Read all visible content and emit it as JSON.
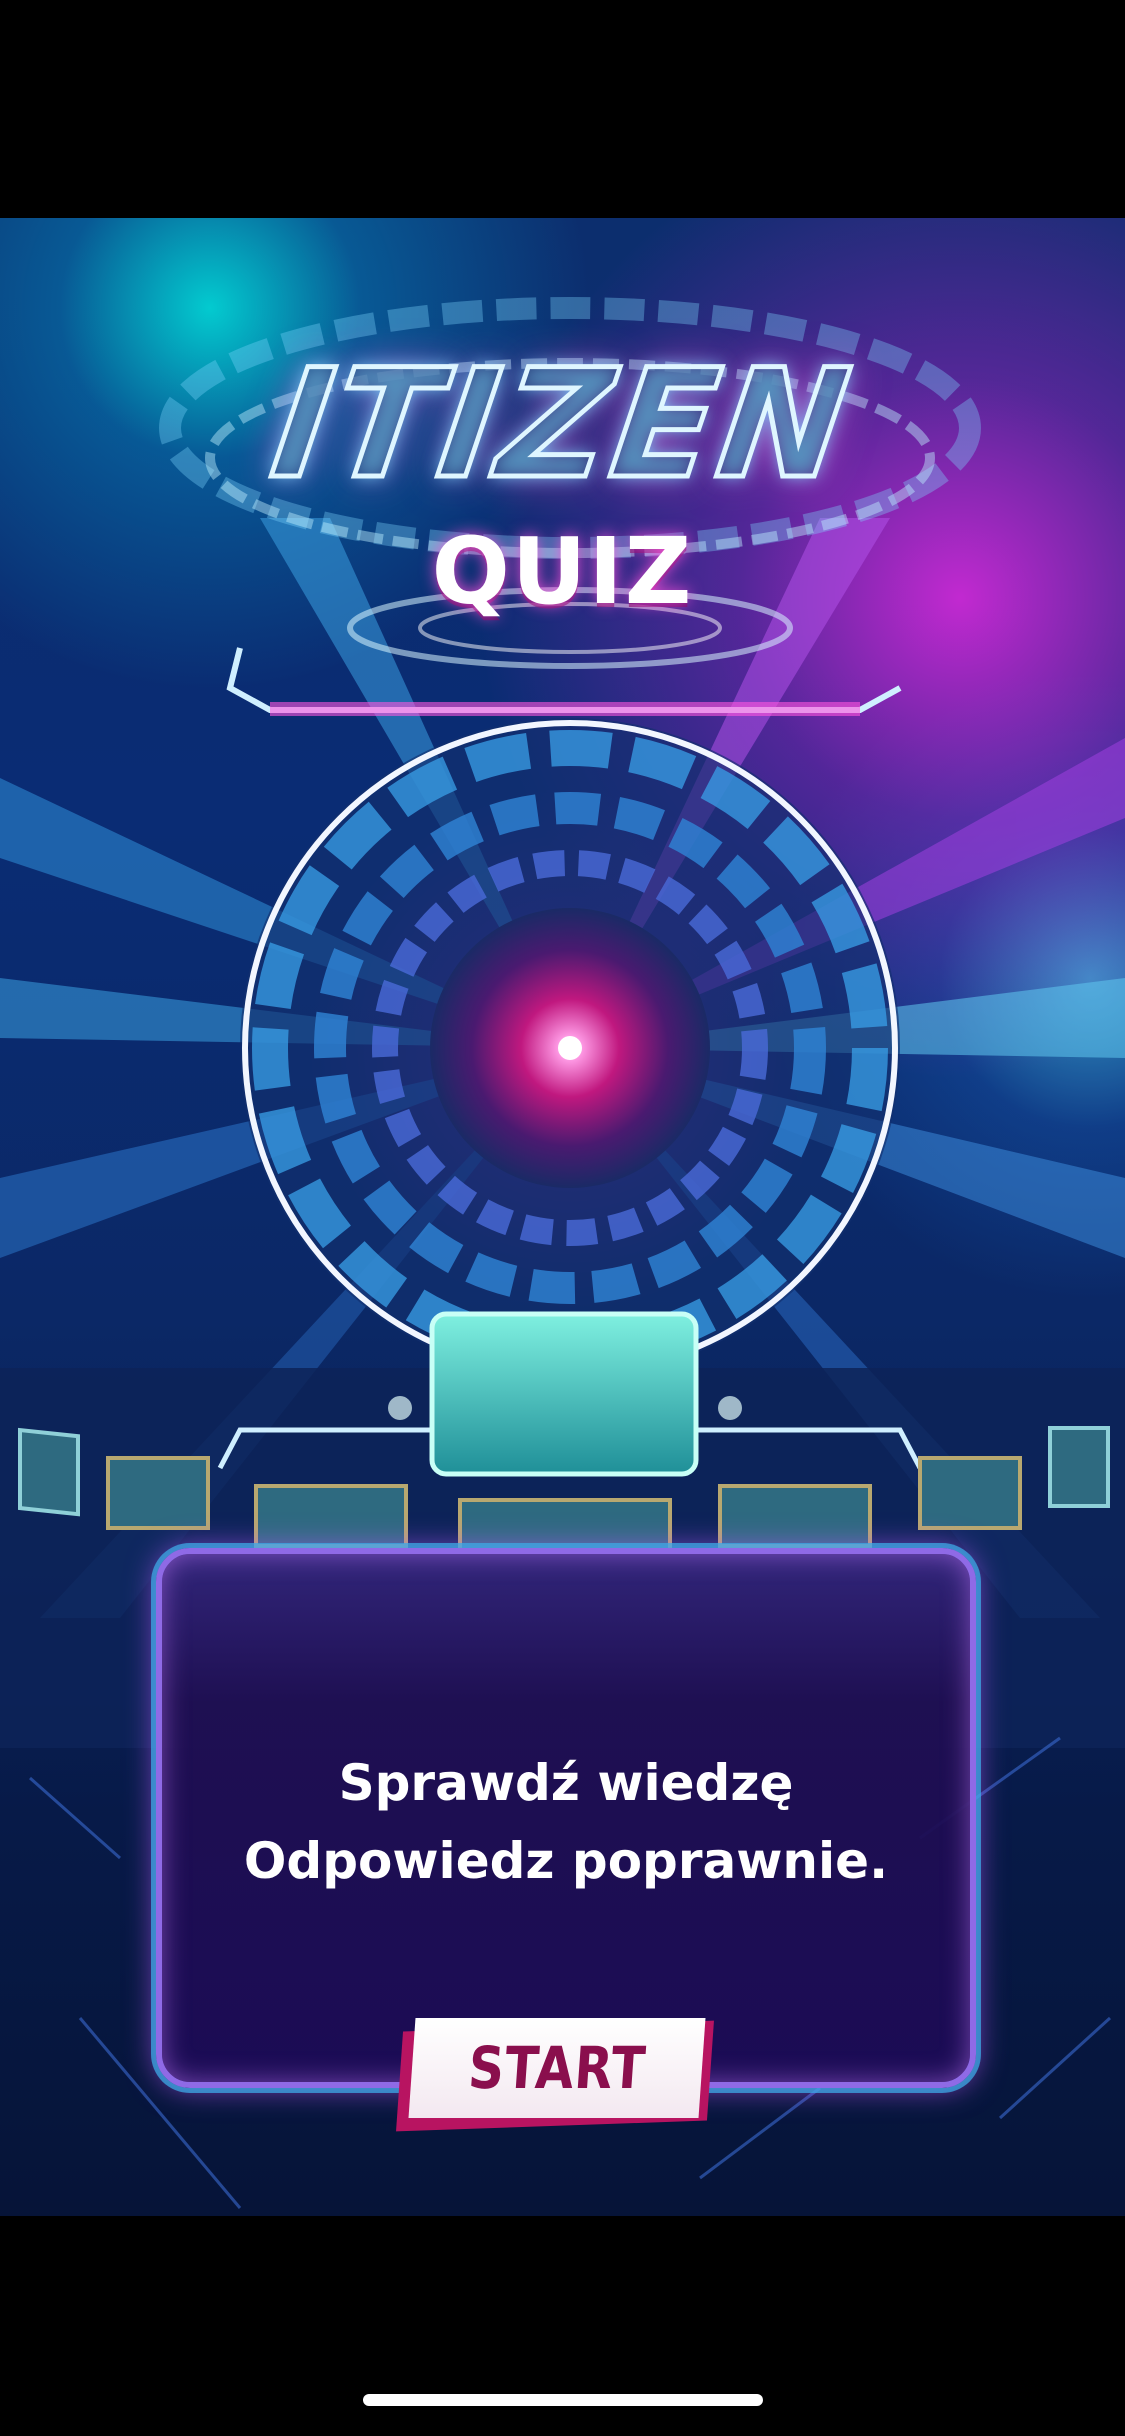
{
  "logo": {
    "title": "ITIZEN",
    "subtitle": "QUIZ"
  },
  "panel": {
    "line1": "Sprawdź wiedzę",
    "line2": "Odpowiedz poprawnie."
  },
  "start_button": {
    "label": "START"
  },
  "colors": {
    "background_top": "#0c2e6e",
    "background_bottom": "#061438",
    "accent_cyan": "#00f0ff",
    "accent_magenta": "#ff28f0",
    "panel_fill": "#1b0c55",
    "panel_border": "#8f6ae6",
    "button_text": "#8a0f4d",
    "button_shadow": "#b81461"
  }
}
